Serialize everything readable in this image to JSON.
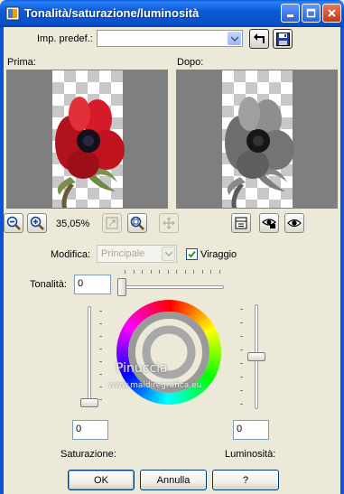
{
  "window": {
    "title": "Tonalità/saturazione/luminosità",
    "controls": [
      "minimize-icon",
      "maximize-icon",
      "close-icon"
    ],
    "title_color": "#0b55d4"
  },
  "presets": {
    "label": "Imp. predef.:",
    "value": ""
  },
  "previews": {
    "before_label": "Prima:",
    "after_label": "Dopo:"
  },
  "zoom": {
    "level": "35,05%"
  },
  "modify": {
    "label": "Modifica:",
    "value": "Principale",
    "colorize_label": "Viraggio",
    "colorize_checked": true
  },
  "hue": {
    "label": "Tonalità:",
    "value": "0"
  },
  "saturation": {
    "label": "Saturazione:",
    "value": "0"
  },
  "lightness": {
    "label": "Luminosità:",
    "value": "0"
  },
  "watermark": {
    "line1": "Pinuccia",
    "line2": "www.maidiregrafica.eu"
  },
  "buttons": {
    "ok": "OK",
    "cancel": "Annulla",
    "help": "?"
  }
}
